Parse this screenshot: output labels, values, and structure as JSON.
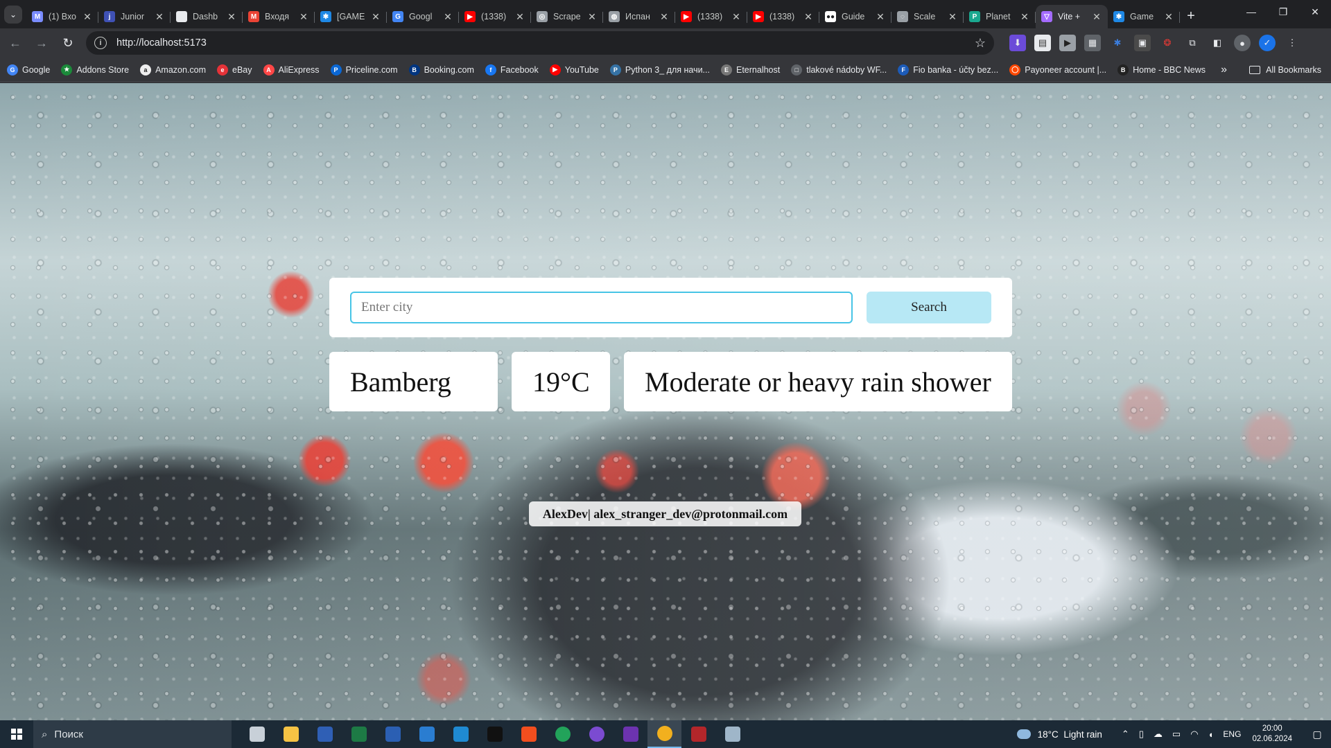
{
  "browser": {
    "tabs": [
      {
        "title": "(1) Вхо",
        "icon": "gmail-icon",
        "color": "#7a8cff",
        "glyph": "M",
        "active": false
      },
      {
        "title": "Junior",
        "icon": "junior-icon",
        "color": "#3f51b5",
        "glyph": "j",
        "active": false
      },
      {
        "title": "Dashb",
        "icon": "dashboard-icon",
        "color": "#e8eaed",
        "glyph": "",
        "active": false
      },
      {
        "title": "Входя",
        "icon": "gmail-icon",
        "color": "#ea4335",
        "glyph": "M",
        "active": false
      },
      {
        "title": "[GAME",
        "icon": "game-icon",
        "color": "#1e88e5",
        "glyph": "✱",
        "active": false
      },
      {
        "title": "Googl",
        "icon": "google-translate-icon",
        "color": "#4285f4",
        "glyph": "G",
        "active": false
      },
      {
        "title": "(1338)",
        "icon": "youtube-icon",
        "color": "#ff0000",
        "glyph": "▶",
        "active": false
      },
      {
        "title": "Scrape",
        "icon": "openai-icon",
        "color": "#9aa0a6",
        "glyph": "◎",
        "active": false
      },
      {
        "title": "Испан",
        "icon": "globe-icon",
        "color": "#9aa0a6",
        "glyph": "◍",
        "active": false
      },
      {
        "title": "(1338)",
        "icon": "youtube-icon",
        "color": "#ff0000",
        "glyph": "▶",
        "active": false
      },
      {
        "title": "(1338)",
        "icon": "youtube-icon",
        "color": "#ff0000",
        "glyph": "▶",
        "active": false
      },
      {
        "title": "Guide",
        "icon": "medium-icon",
        "color": "#ffffff",
        "glyph": "●●",
        "active": false
      },
      {
        "title": "Scale",
        "icon": "scale-icon",
        "color": "#9aa0a6",
        "glyph": "◌",
        "active": false
      },
      {
        "title": "Planet",
        "icon": "planet-icon",
        "color": "#1aa88f",
        "glyph": "P",
        "active": false
      },
      {
        "title": "Vite +",
        "icon": "vite-icon",
        "color": "#a46bff",
        "glyph": "▽",
        "active": true
      },
      {
        "title": "Game",
        "icon": "game-icon",
        "color": "#1e88e5",
        "glyph": "✱",
        "active": false
      }
    ],
    "new_tab": "+",
    "close_glyph": "✕",
    "window_controls": {
      "minimize": "—",
      "restore": "❐",
      "close": "✕"
    },
    "url": "http://localhost:5173",
    "bookmarks": [
      {
        "label": "Google",
        "icon": "google-icon",
        "color": "#4285f4",
        "glyph": "G"
      },
      {
        "label": "Addons Store",
        "icon": "addons-icon",
        "color": "#1b8a3a",
        "glyph": "★"
      },
      {
        "label": "Amazon.com",
        "icon": "amazon-icon",
        "color": "#eeeeee",
        "glyph": "a"
      },
      {
        "label": "eBay",
        "icon": "ebay-icon",
        "color": "#e53238",
        "glyph": "e"
      },
      {
        "label": "AliExpress",
        "icon": "aliexpress-icon",
        "color": "#ff4747",
        "glyph": "A"
      },
      {
        "label": "Priceline.com",
        "icon": "priceline-icon",
        "color": "#0a67d4",
        "glyph": "P"
      },
      {
        "label": "Booking.com",
        "icon": "booking-icon",
        "color": "#003580",
        "glyph": "B"
      },
      {
        "label": "Facebook",
        "icon": "facebook-icon",
        "color": "#1877f2",
        "glyph": "f"
      },
      {
        "label": "YouTube",
        "icon": "youtube-icon",
        "color": "#ff0000",
        "glyph": "▶"
      },
      {
        "label": "Python 3_ для начи...",
        "icon": "python-icon",
        "color": "#3572a5",
        "glyph": "P"
      },
      {
        "label": "Eternalhost",
        "icon": "eternalhost-icon",
        "color": "#777777",
        "glyph": "E"
      },
      {
        "label": "tlakové nádoby WF...",
        "icon": "page-icon",
        "color": "#5f6368",
        "glyph": "□"
      },
      {
        "label": "Fio banka - účty bez...",
        "icon": "fio-icon",
        "color": "#1c5bb8",
        "glyph": "F"
      },
      {
        "label": "Payoneer account |...",
        "icon": "payoneer-icon",
        "color": "#ff4800",
        "glyph": "◯"
      },
      {
        "label": "Home - BBC News",
        "icon": "bbc-icon",
        "color": "#222222",
        "glyph": "B"
      }
    ],
    "more_bookmarks": "»",
    "all_bookmarks": "All Bookmarks"
  },
  "app": {
    "search": {
      "placeholder": "Enter city",
      "value": "",
      "button_label": "Search"
    },
    "weather": {
      "city": "Bamberg",
      "temperature": "19°C",
      "condition": "Moderate or heavy rain shower"
    },
    "footer": "AlexDev| alex_stranger_dev@protonmail.com",
    "accent_color": "#47c4e6",
    "button_color": "#b7e8f5"
  },
  "taskbar": {
    "search_placeholder": "Поиск",
    "apps": [
      {
        "name": "task-view-icon",
        "color": "#c8d0d8"
      },
      {
        "name": "file-explorer-icon",
        "color": "#f6c344"
      },
      {
        "name": "save-app-icon",
        "color": "#2f5fb5"
      },
      {
        "name": "excel-icon",
        "color": "#1d7a45"
      },
      {
        "name": "word-icon",
        "color": "#2b5fb3"
      },
      {
        "name": "outlook-icon",
        "color": "#2a7dd1"
      },
      {
        "name": "vscode-icon",
        "color": "#1f8ad2"
      },
      {
        "name": "terminal-icon",
        "color": "#111111"
      },
      {
        "name": "figma-icon",
        "color": "#f24e1e"
      },
      {
        "name": "app-green-icon",
        "color": "#22a35a"
      },
      {
        "name": "github-desktop-icon",
        "color": "#7b4bd1"
      },
      {
        "name": "visual-studio-icon",
        "color": "#6c33af"
      },
      {
        "name": "chrome-canary-icon",
        "color": "#f2b01e"
      },
      {
        "name": "app-red-icon",
        "color": "#b3262a"
      },
      {
        "name": "remote-desktop-icon",
        "color": "#9fb6c9"
      }
    ],
    "weather_temp": "18°C",
    "weather_text": "Light rain",
    "language": "ENG",
    "time": "20:00",
    "date": "02.06.2024"
  }
}
